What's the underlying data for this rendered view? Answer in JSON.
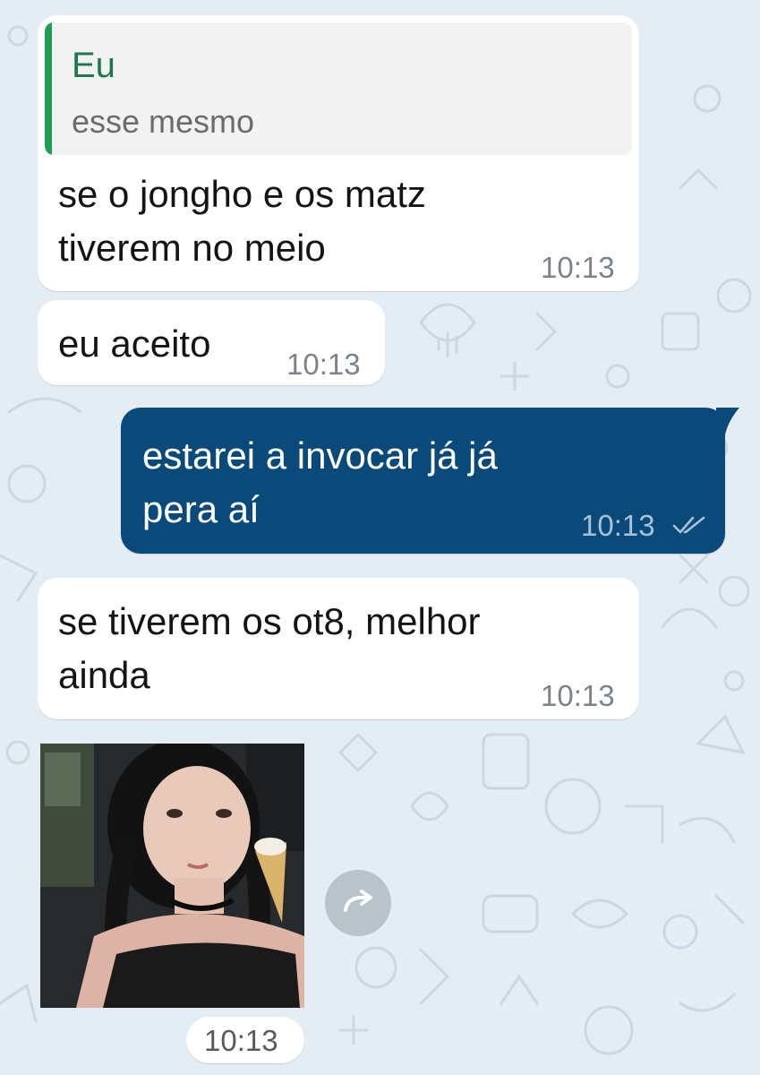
{
  "messages": [
    {
      "direction": "incoming",
      "reply": {
        "author": "Eu",
        "text": "esse mesmo"
      },
      "text": "se o jongho e os matz\ntiverem no meio",
      "time": "10:13"
    },
    {
      "direction": "incoming",
      "text": "eu aceito",
      "time": "10:13"
    },
    {
      "direction": "outgoing",
      "text": "estarei a invocar já já\npera aí",
      "time": "10:13",
      "status": "read-double-check-icon"
    },
    {
      "direction": "incoming",
      "text": "se tiverem os ot8, melhor\nainda",
      "time": "10:13"
    },
    {
      "direction": "incoming",
      "media": {
        "type": "image",
        "icon": "forward-icon"
      },
      "time": "10:13"
    }
  ],
  "colors": {
    "background": "#e3edf3",
    "incoming_bubble": "#ffffff",
    "outgoing_bubble": "#0a4a7a",
    "reply_accent": "#1f9d55"
  }
}
